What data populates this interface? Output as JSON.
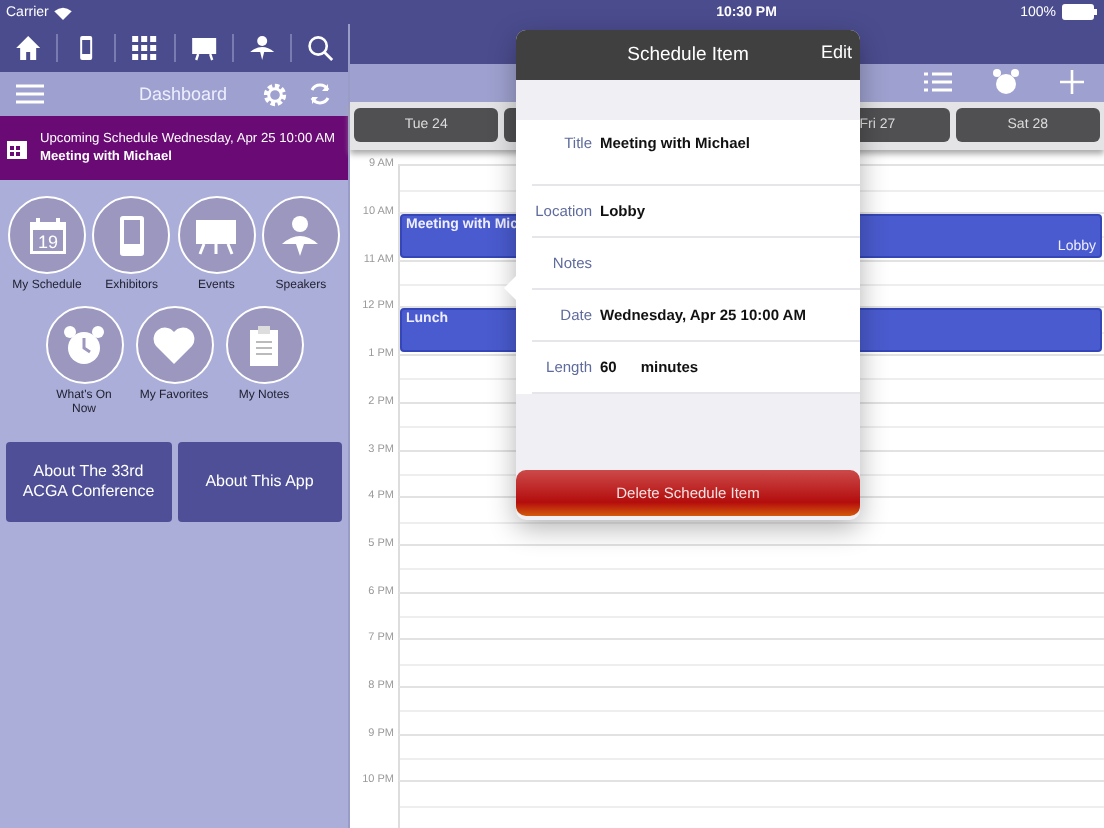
{
  "status_bar": {
    "carrier": "Carrier",
    "time": "10:30 PM",
    "battery": "100%"
  },
  "sidebar": {
    "title": "Dashboard",
    "upcoming": {
      "text": "Upcoming Schedule Wednesday, Apr 25 10:00 AM",
      "title": "Meeting with Michael"
    },
    "tiles": [
      {
        "label": "My Schedule",
        "icon_text": "19"
      },
      {
        "label": "Exhibitors"
      },
      {
        "label": "Events"
      },
      {
        "label": "Speakers"
      }
    ],
    "tiles_2": [
      {
        "label": "What's On Now"
      },
      {
        "label": "My Favorites"
      },
      {
        "label": "My Notes"
      }
    ],
    "buttons": [
      "About The 33rd ACGA Conference",
      "About This App"
    ]
  },
  "calendar": {
    "days": [
      {
        "label": "Tue 24"
      },
      {
        "label": "Fri 27"
      },
      {
        "label": "Sat 28"
      }
    ],
    "hours": [
      {
        "label": "9 AM"
      },
      {
        "label": "10 AM",
        "event": {
          "title": "Meeting with Mic",
          "location": "Lobby"
        }
      },
      {
        "label": "11 AM"
      },
      {
        "label": "12 PM",
        "event": {
          "title": "Lunch"
        }
      },
      {
        "label": "1 PM"
      },
      {
        "label": "2 PM"
      },
      {
        "label": "3 PM"
      },
      {
        "label": "4 PM"
      },
      {
        "label": "5 PM"
      },
      {
        "label": "6 PM"
      },
      {
        "label": "7 PM"
      },
      {
        "label": "8 PM"
      },
      {
        "label": "9 PM"
      },
      {
        "label": "10 PM"
      }
    ]
  },
  "popover": {
    "title": "Schedule Item",
    "edit": "Edit",
    "fields": [
      {
        "label": "Title",
        "value": "Meeting with Michael"
      },
      {
        "label": "Location",
        "value": "Lobby"
      },
      {
        "label": "Notes"
      },
      {
        "label": "Date",
        "value": "Wednesday, Apr 25 10:00 AM"
      },
      {
        "label": "Length",
        "value": "60",
        "unit": "minutes"
      }
    ],
    "delete": "Delete Schedule Item"
  }
}
